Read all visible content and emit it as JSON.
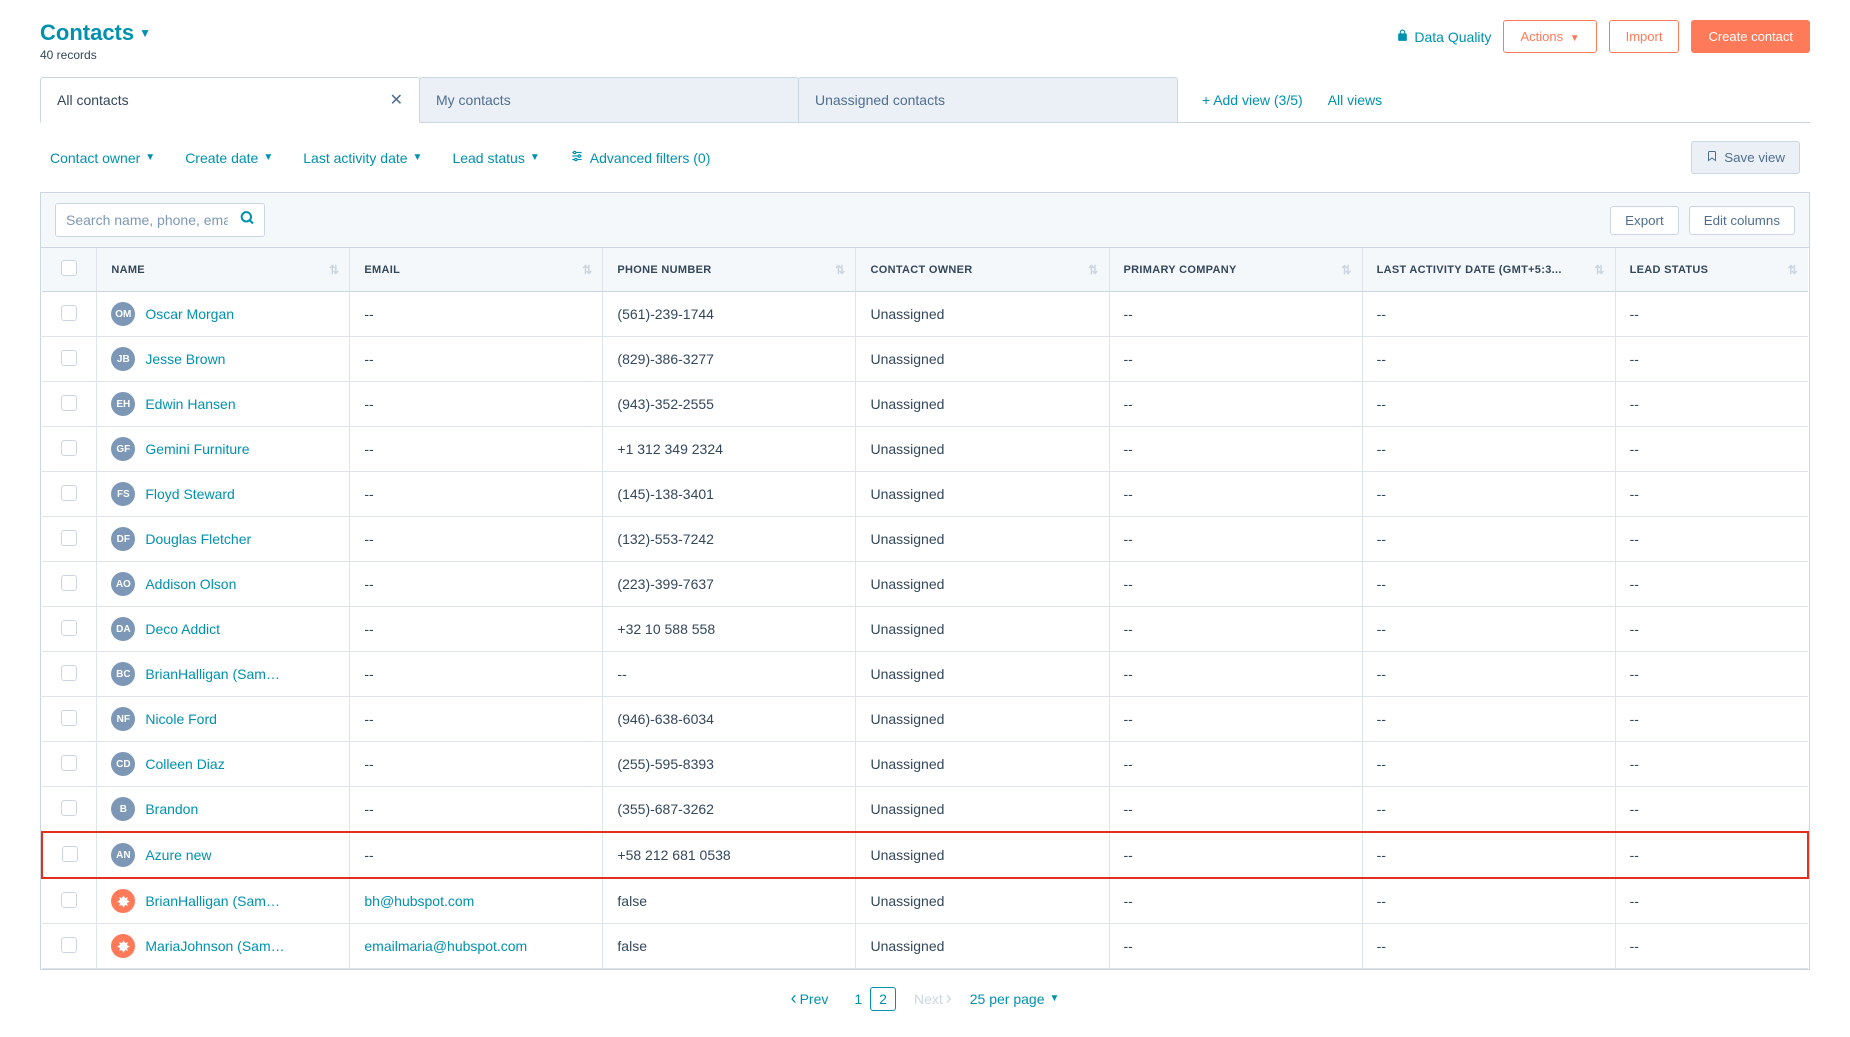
{
  "header": {
    "title": "Contacts",
    "records": "40 records",
    "data_quality": "Data Quality",
    "actions_btn": "Actions",
    "import_btn": "Import",
    "create_btn": "Create contact"
  },
  "tabs": {
    "items": [
      {
        "label": "All contacts",
        "active": true,
        "closable": true
      },
      {
        "label": "My contacts",
        "active": false,
        "closable": false
      },
      {
        "label": "Unassigned contacts",
        "active": false,
        "closable": false
      }
    ],
    "add_view": "Add view (3/5)",
    "all_views": "All views"
  },
  "filters": {
    "items": [
      "Contact owner",
      "Create date",
      "Last activity date",
      "Lead status"
    ],
    "advanced": "Advanced filters (0)",
    "save_view": "Save view"
  },
  "search": {
    "placeholder": "Search name, phone, email",
    "export_btn": "Export",
    "edit_cols_btn": "Edit columns"
  },
  "columns": [
    "NAME",
    "EMAIL",
    "PHONE NUMBER",
    "CONTACT OWNER",
    "PRIMARY COMPANY",
    "LAST ACTIVITY DATE (GMT+5:3...",
    "LEAD STATUS"
  ],
  "rows": [
    {
      "initials": "OM",
      "name": "Oscar Morgan",
      "email": "--",
      "phone": "(561)-239-1744",
      "owner": "Unassigned",
      "company": "--",
      "activity": "--",
      "lead": "--"
    },
    {
      "initials": "JB",
      "name": "Jesse Brown",
      "email": "--",
      "phone": "(829)-386-3277",
      "owner": "Unassigned",
      "company": "--",
      "activity": "--",
      "lead": "--"
    },
    {
      "initials": "EH",
      "name": "Edwin Hansen",
      "email": "--",
      "phone": "(943)-352-2555",
      "owner": "Unassigned",
      "company": "--",
      "activity": "--",
      "lead": "--"
    },
    {
      "initials": "GF",
      "name": "Gemini Furniture",
      "email": "--",
      "phone": "+1 312 349 2324",
      "owner": "Unassigned",
      "company": "--",
      "activity": "--",
      "lead": "--"
    },
    {
      "initials": "FS",
      "name": "Floyd Steward",
      "email": "--",
      "phone": "(145)-138-3401",
      "owner": "Unassigned",
      "company": "--",
      "activity": "--",
      "lead": "--"
    },
    {
      "initials": "DF",
      "name": "Douglas Fletcher",
      "email": "--",
      "phone": "(132)-553-7242",
      "owner": "Unassigned",
      "company": "--",
      "activity": "--",
      "lead": "--"
    },
    {
      "initials": "AO",
      "name": "Addison Olson",
      "email": "--",
      "phone": "(223)-399-7637",
      "owner": "Unassigned",
      "company": "--",
      "activity": "--",
      "lead": "--"
    },
    {
      "initials": "DA",
      "name": "Deco Addict",
      "email": "--",
      "phone": "+32 10 588 558",
      "owner": "Unassigned",
      "company": "--",
      "activity": "--",
      "lead": "--"
    },
    {
      "initials": "BC",
      "name": "BrianHalligan (Sampl...",
      "email": "--",
      "phone": "--",
      "owner": "Unassigned",
      "company": "--",
      "activity": "--",
      "lead": "--"
    },
    {
      "initials": "NF",
      "name": "Nicole Ford",
      "email": "--",
      "phone": "(946)-638-6034",
      "owner": "Unassigned",
      "company": "--",
      "activity": "--",
      "lead": "--"
    },
    {
      "initials": "CD",
      "name": "Colleen Diaz",
      "email": "--",
      "phone": "(255)-595-8393",
      "owner": "Unassigned",
      "company": "--",
      "activity": "--",
      "lead": "--"
    },
    {
      "initials": "B",
      "name": "Brandon",
      "email": "--",
      "phone": "(355)-687-3262",
      "owner": "Unassigned",
      "company": "--",
      "activity": "--",
      "lead": "--"
    },
    {
      "initials": "AN",
      "name": "Azure new",
      "email": "--",
      "phone": "+58 212 681 0538",
      "owner": "Unassigned",
      "company": "--",
      "activity": "--",
      "lead": "--",
      "highlight": true
    },
    {
      "initials": "sprocket",
      "name": "BrianHalligan (Sampl...",
      "email": "bh@hubspot.com",
      "phone": "false",
      "owner": "Unassigned",
      "company": "--",
      "activity": "--",
      "lead": "--",
      "orange": true
    },
    {
      "initials": "sprocket",
      "name": "MariaJohnson (Sampl...",
      "email": "emailmaria@hubspot.com",
      "phone": "false",
      "owner": "Unassigned",
      "company": "--",
      "activity": "--",
      "lead": "--",
      "orange": true
    }
  ],
  "pagination": {
    "prev": "Prev",
    "next": "Next",
    "pages": [
      "1",
      "2"
    ],
    "current": "2",
    "per_page": "25 per page"
  }
}
